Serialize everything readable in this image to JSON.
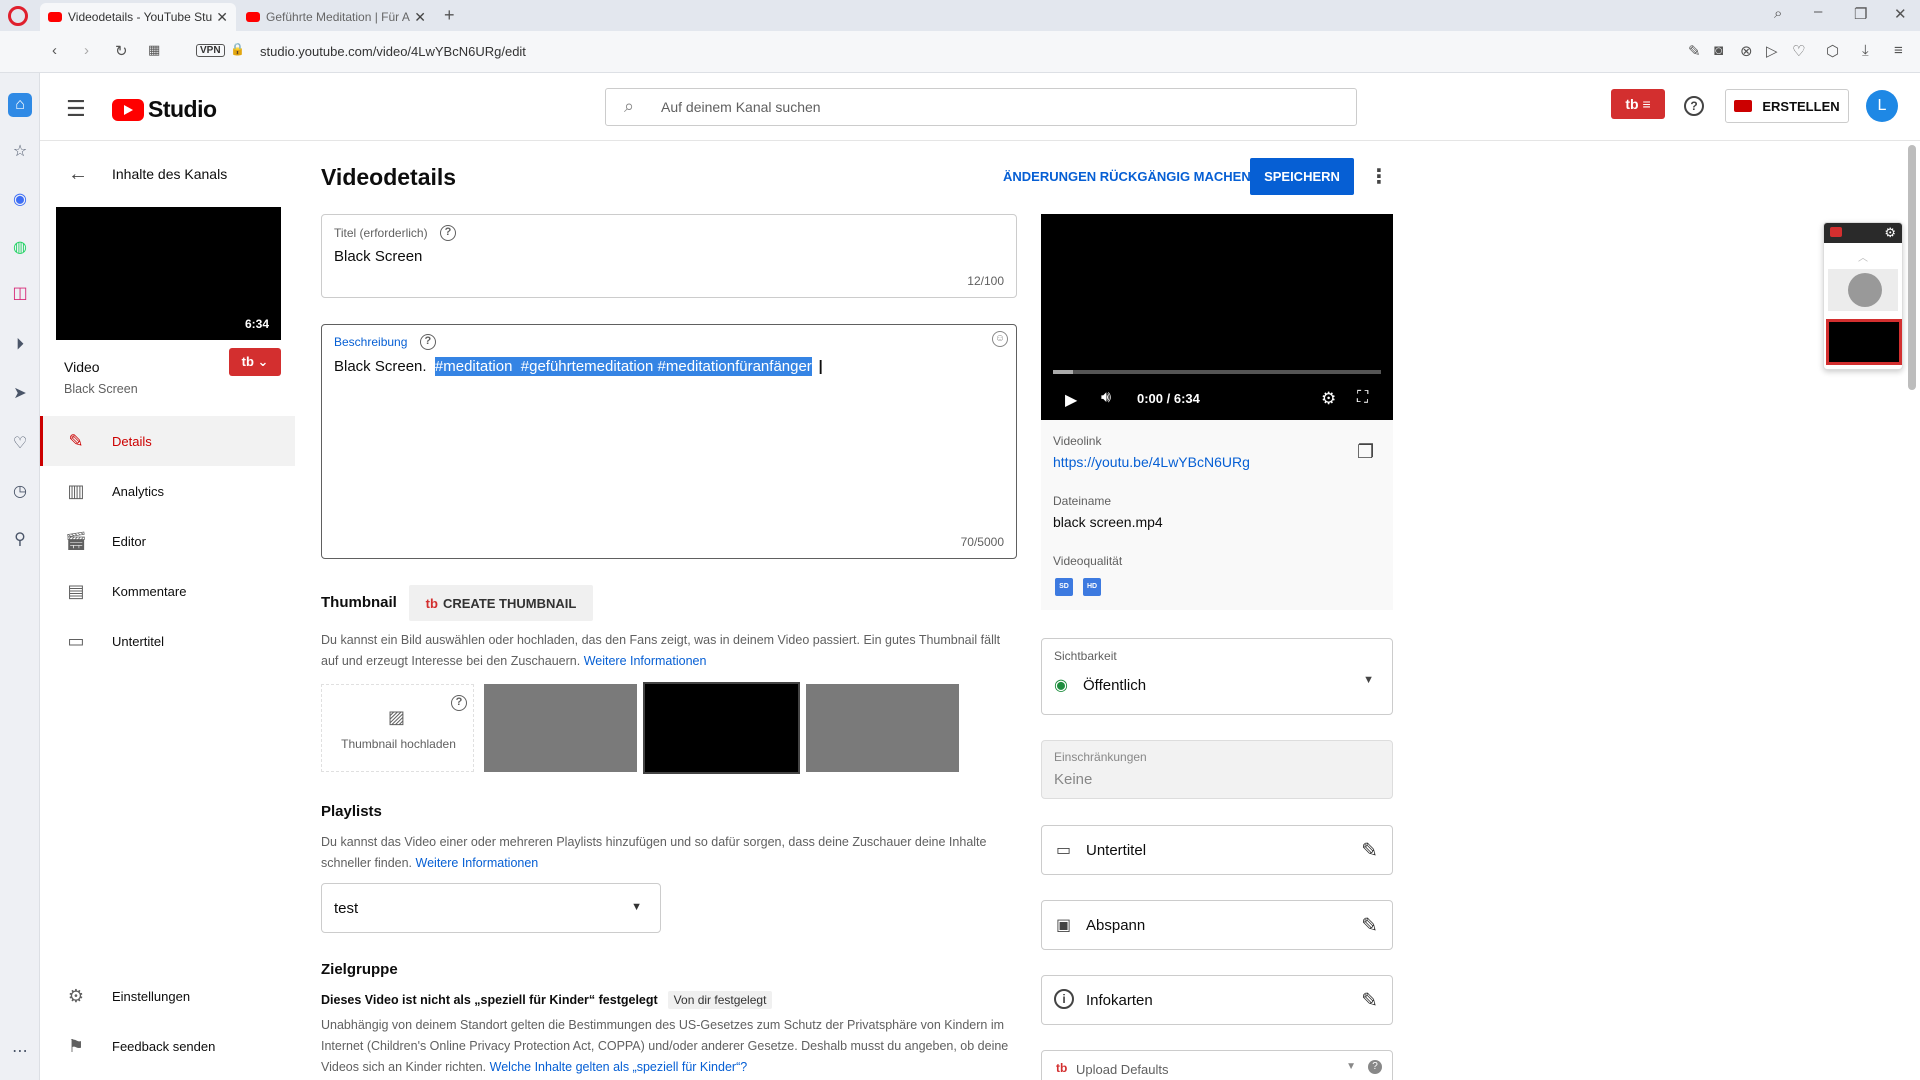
{
  "browser": {
    "tabs": [
      {
        "title": "Videodetails - YouTube Stu",
        "active": true
      },
      {
        "title": "Geführte Meditation | Für A",
        "active": false
      }
    ],
    "url": "studio.youtube.com/video/4LwYBcN6URg/edit",
    "vpn_label": "VPN"
  },
  "header": {
    "logo_text": "Studio",
    "search_placeholder": "Auf deinem Kanal suchen",
    "create_label": "ERSTELLEN",
    "avatar_letter": "L",
    "brand_color": "#ff0000"
  },
  "sidebar": {
    "back_label": "Inhalte des Kanals",
    "thumb_duration": "6:34",
    "video_heading": "Video",
    "video_title": "Black Screen",
    "items": [
      {
        "label": "Details",
        "icon": "pencil-icon",
        "active": true
      },
      {
        "label": "Analytics",
        "icon": "bar-chart-icon",
        "active": false
      },
      {
        "label": "Editor",
        "icon": "clapper-icon",
        "active": false
      },
      {
        "label": "Kommentare",
        "icon": "comment-icon",
        "active": false
      },
      {
        "label": "Untertitel",
        "icon": "subtitles-icon",
        "active": false
      }
    ],
    "bottom": [
      {
        "label": "Einstellungen",
        "icon": "gear-icon"
      },
      {
        "label": "Feedback senden",
        "icon": "feedback-icon"
      }
    ]
  },
  "main": {
    "page_title": "Videodetails",
    "undo_label": "ÄNDERUNGEN RÜCKGÄNGIG MACHEN",
    "save_label": "SPEICHERN",
    "title_field": {
      "label": "Titel (erforderlich)",
      "value": "Black Screen",
      "counter": "12/100"
    },
    "description_field": {
      "label": "Beschreibung",
      "plain": "Black Screen.",
      "selected": "#meditation  #geführtemeditation #meditationfüranfänger",
      "counter": "70/5000"
    },
    "thumbnail": {
      "title": "Thumbnail",
      "create_button": "CREATE THUMBNAIL",
      "description": "Du kannst ein Bild auswählen oder hochladen, das den Fans zeigt, was in deinem Video passiert. Ein gutes Thumbnail fällt auf und erzeugt Interesse bei den Zuschauern.",
      "more_link": "Weitere Informationen",
      "upload_label": "Thumbnail hochladen"
    },
    "playlists": {
      "title": "Playlists",
      "description": "Du kannst das Video einer oder mehreren Playlists hinzufügen und so dafür sorgen, dass deine Zuschauer deine Inhalte schneller finden.",
      "more_link": "Weitere Informationen",
      "selected": "test"
    },
    "audience": {
      "title": "Zielgruppe",
      "status": "Dieses Video ist nicht als „speziell für Kinder“ festgelegt",
      "badge": "Von dir festgelegt",
      "description": "Unabhängig von deinem Standort gelten die Bestimmungen des US-Gesetzes zum Schutz der Privatsphäre von Kindern im Internet (Children's Online Privacy Protection Act, COPPA) und/oder anderer Gesetze. Deshalb musst du angeben, ob deine Videos sich an Kinder richten.",
      "link": "Welche Inhalte gelten als „speziell für Kinder“?"
    }
  },
  "preview": {
    "time": "0:00 / 6:34",
    "link_label": "Videolink",
    "link": "https://youtu.be/4LwYBcN6URg",
    "filename_label": "Dateiname",
    "filename": "black screen.mp4",
    "quality_label": "Videoqualität",
    "quality_badges": [
      "SD",
      "HD"
    ],
    "visibility_label": "Sichtbarkeit",
    "visibility": "Öffentlich",
    "restrictions_label": "Einschränkungen",
    "restrictions": "Keine",
    "rows": [
      "Untertitel",
      "Abspann",
      "Infokarten"
    ],
    "upload_defaults": "Upload Defaults"
  }
}
